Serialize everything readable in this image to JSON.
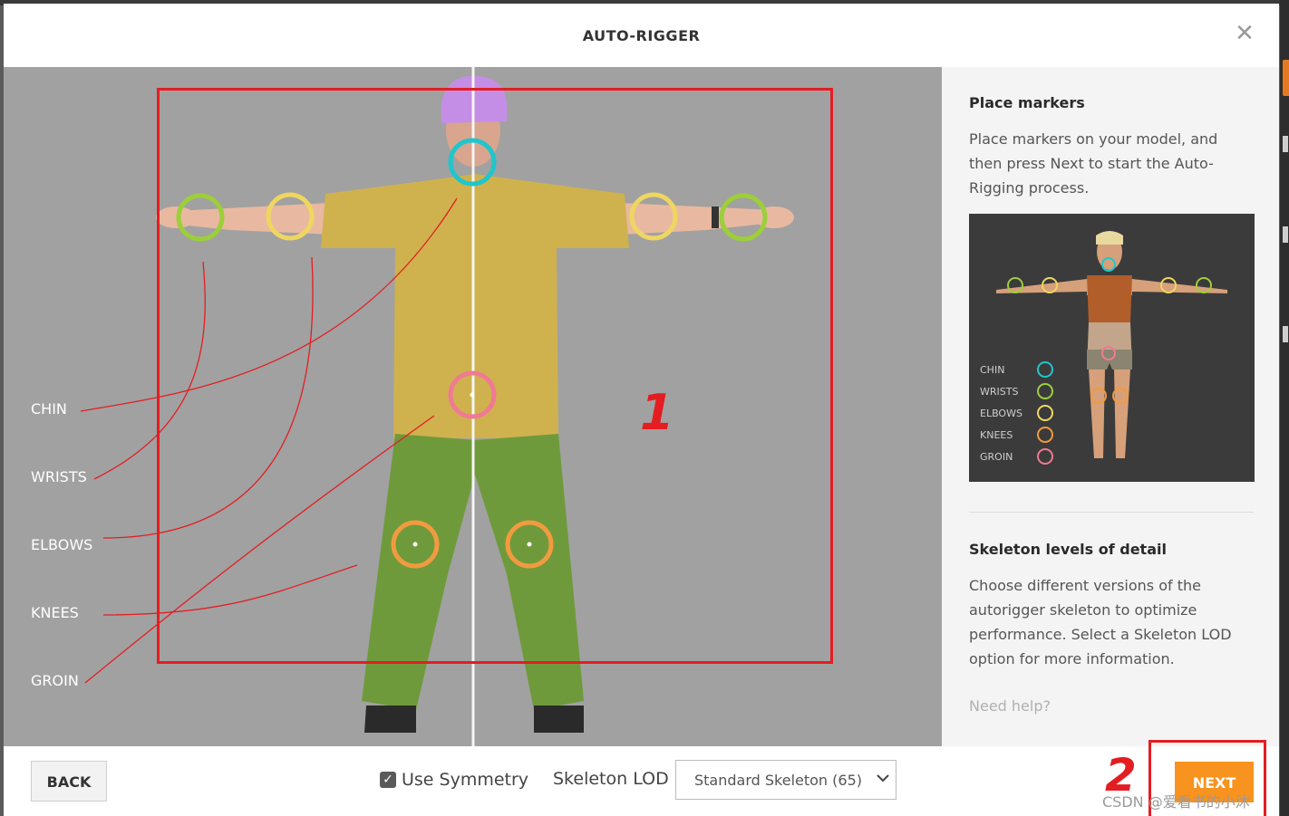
{
  "modal": {
    "title": "AUTO-RIGGER",
    "close_icon": "close-x-icon"
  },
  "viewport": {
    "marker_labels": [
      "CHIN",
      "WRISTS",
      "ELBOWS",
      "KNEES",
      "GROIN"
    ],
    "annotation_box_number": "1"
  },
  "sidebar": {
    "heading1": "Place markers",
    "text1": "Place markers on your model, and then press Next to start the Auto-Rigging process.",
    "preview_legend": [
      "CHIN",
      "WRISTS",
      "ELBOWS",
      "KNEES",
      "GROIN"
    ],
    "heading2": "Skeleton levels of detail",
    "text2": "Choose different versions of the autorigger skeleton to optimize performance. Select a Skeleton LOD option for more information.",
    "help_link": "Need help?"
  },
  "footer": {
    "back_label": "BACK",
    "symmetry_label": "Use Symmetry",
    "symmetry_checked": true,
    "lod_label": "Skeleton LOD",
    "lod_selected": "Standard Skeleton (65)",
    "next_label": "NEXT",
    "annotation_number": "2",
    "watermark": "CSDN @爱看书的小沐"
  },
  "colors": {
    "chin": "#1fc6cc",
    "wrists": "#9ccf3a",
    "elbows": "#efd660",
    "knees": "#f29a3f",
    "groin": "#f07a93",
    "next_button": "#f7931e",
    "annotation_red": "#e41d22"
  }
}
